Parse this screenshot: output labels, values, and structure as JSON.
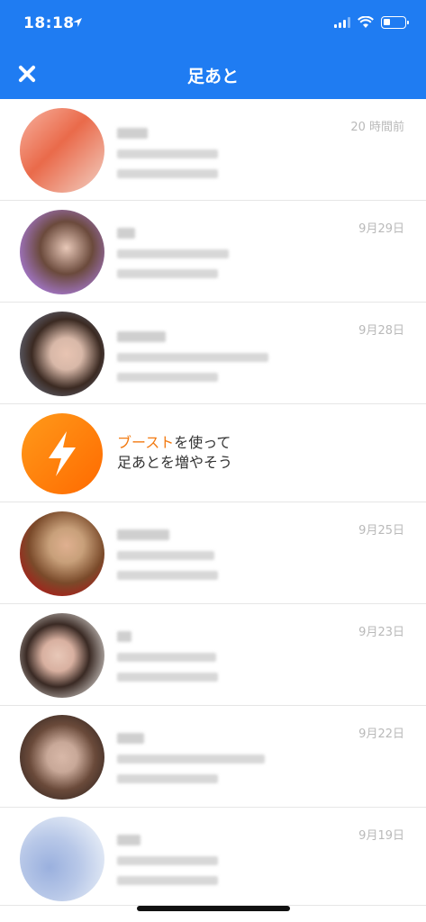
{
  "status_bar": {
    "time": "18:18"
  },
  "header": {
    "title": "足あと",
    "close_icon": "close-icon"
  },
  "footprints": [
    {
      "date": "20 時間前",
      "avatar_colors": [
        "#f7b2a0",
        "#ea6a4a",
        "#f2d0c4"
      ]
    },
    {
      "date": "9月29日",
      "avatar_colors": [
        "#cfc3e6",
        "#6b4a3c",
        "#a87ad6"
      ]
    },
    {
      "date": "9月28日",
      "avatar_colors": [
        "#3b2a22",
        "#d8b8a8",
        "#7a8aa8"
      ]
    },
    {
      "date": "9月25日",
      "avatar_colors": [
        "#7a4a2a",
        "#c8a07a",
        "#b01818"
      ]
    },
    {
      "date": "9月23日",
      "avatar_colors": [
        "#e8e4e0",
        "#3a2a24",
        "#d8b0a0"
      ]
    },
    {
      "date": "9月22日",
      "avatar_colors": [
        "#6a4a3a",
        "#c8a898",
        "#3a2a24"
      ]
    },
    {
      "date": "9月19日",
      "avatar_colors": [
        "#e4ebf6",
        "#b8c8e8",
        "#9ab0de"
      ]
    }
  ],
  "boost": {
    "accent": "ブースト",
    "text1": "を使って",
    "text2": "足あとを増やそう",
    "icon": "lightning-icon"
  }
}
